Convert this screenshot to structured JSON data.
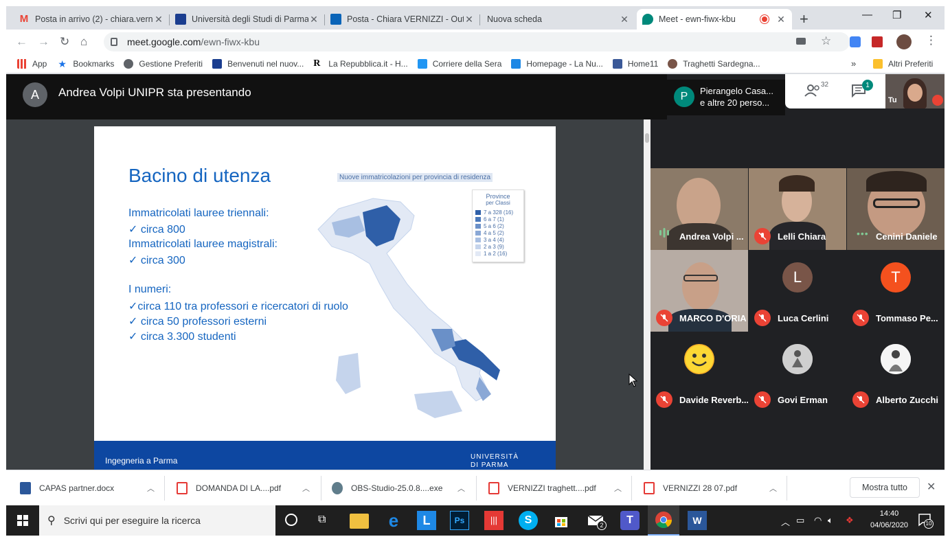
{
  "tabs": [
    {
      "label": "Posta in arrivo (2) - chiara.verne",
      "icon": "gmail-icon",
      "color": "#ea4335"
    },
    {
      "label": "Università degli Studi di Parma",
      "icon": "unipr-icon",
      "color": "#1a3d8f"
    },
    {
      "label": "Posta - Chiara VERNIZZI - Outl",
      "icon": "outlook-icon",
      "color": "#0a64b8"
    },
    {
      "label": "Nuova scheda",
      "icon": "",
      "color": ""
    },
    {
      "label": "Meet - ewn-fiwx-kbu",
      "icon": "meet-icon",
      "color": "#00897b"
    }
  ],
  "new_tab_label": "+",
  "window_controls": {
    "minimize": "—",
    "maximize": "❐",
    "close": "✕"
  },
  "url": {
    "host": "meet.google.com",
    "path": "/ewn-fiwx-kbu"
  },
  "bookmarks": [
    {
      "label": "App",
      "color": "#4285f4"
    },
    {
      "label": "Bookmarks",
      "color": "#1a73e8"
    },
    {
      "label": "Gestione Preferiti",
      "color": "#5f6368"
    },
    {
      "label": "Benvenuti nel nuov...",
      "color": "#1a3d8f"
    },
    {
      "label": "La Repubblica.it - H...",
      "color": "#000000"
    },
    {
      "label": "Corriere della Sera",
      "color": "#2196f3"
    },
    {
      "label": "Homepage - La Nu...",
      "color": "#1e88e5"
    },
    {
      "label": "Home11",
      "color": "#3b5998"
    },
    {
      "label": "Traghetti Sardegna...",
      "color": "#795548"
    }
  ],
  "bookmarks_overflow": "»",
  "other_bookmarks": "Altri Preferiti",
  "presenter": {
    "initial": "A",
    "title": "Andrea Volpi UNIPR sta presentando"
  },
  "participants_chip": {
    "initial": "P",
    "line1": "Pierangelo Casa...",
    "line2": "e altre 20 perso..."
  },
  "people_count": "32",
  "chat_badge": "1",
  "self_label": "Tu",
  "slide": {
    "title": "Bacino di utenza",
    "lines": [
      "Immatricolati lauree triennali:",
      "✓ circa 800",
      "Immatricolati lauree magistrali:",
      "✓ circa 300",
      "I numeri:",
      "✓circa 110 tra professori e ricercatori di ruolo",
      "✓ circa 50 professori esterni",
      "✓ circa 3.300 studenti"
    ],
    "map_caption": "Nuove immatricolazioni per provincia di residenza",
    "legend_title_1": "Province",
    "legend_title_2": "per Classi",
    "legend": [
      {
        "label": "7 a 328   (16)",
        "color": "#2f5fa8"
      },
      {
        "label": "6 a    7    (1)",
        "color": "#4a78ba"
      },
      {
        "label": "5 a    6    (2)",
        "color": "#6a90c8"
      },
      {
        "label": "4 a    5    (2)",
        "color": "#8aa8d6"
      },
      {
        "label": "3 a    4    (4)",
        "color": "#a8bfe2"
      },
      {
        "label": "2 a    3    (9)",
        "color": "#c5d4ec"
      },
      {
        "label": "1 a    2  (16)",
        "color": "#e2e9f5"
      }
    ],
    "footer_left": "Ingegneria a Parma",
    "footer_right_1": "UNIVERSITÀ",
    "footer_right_2": "DI PARMA"
  },
  "tiles": [
    {
      "name": "Andrea Volpi ...",
      "status": "speaking",
      "kind": "video",
      "bg": "#6b5a4a"
    },
    {
      "name": "Lelli Chiara",
      "status": "muted",
      "kind": "video",
      "bg": "#8a7260"
    },
    {
      "name": "Cenini Daniele",
      "status": "dots",
      "kind": "video",
      "bg": "#5a4e44"
    },
    {
      "name": "MARCO D'ORIA",
      "status": "muted",
      "kind": "video",
      "bg": "#7a6e66"
    },
    {
      "name": "Luca Cerlini",
      "status": "muted",
      "kind": "avatar",
      "initial": "L",
      "bg": "#795548"
    },
    {
      "name": "Tommaso Pe...",
      "status": "muted",
      "kind": "avatar",
      "initial": "T",
      "bg": "#f4511e"
    },
    {
      "name": "Davide Reverb...",
      "status": "muted",
      "kind": "avatar",
      "initial": "",
      "bg": "#fbc02d"
    },
    {
      "name": "Govi Erman",
      "status": "muted",
      "kind": "avatar",
      "initial": "",
      "bg": "#9e9e9e"
    },
    {
      "name": "Alberto Zucchi",
      "status": "muted",
      "kind": "avatar",
      "initial": "",
      "bg": "#e0e0e0"
    }
  ],
  "downloads": [
    {
      "label": "CAPAS partner.docx",
      "color": "#2b579a"
    },
    {
      "label": "DOMANDA DI LA....pdf",
      "color": "#e53935"
    },
    {
      "label": "OBS-Studio-25.0.8....exe",
      "color": "#607d8b"
    },
    {
      "label": "VERNIZZI traghett....pdf",
      "color": "#e53935"
    },
    {
      "label": "VERNIZZI 28 07.pdf",
      "color": "#e53935"
    }
  ],
  "show_all": "Mostra tutto",
  "taskbar": {
    "search_placeholder": "Scrivi qui per eseguire la ricerca",
    "time": "14:40",
    "date": "04/06/2020",
    "mail_badge": "2",
    "notif_badge": "10"
  }
}
